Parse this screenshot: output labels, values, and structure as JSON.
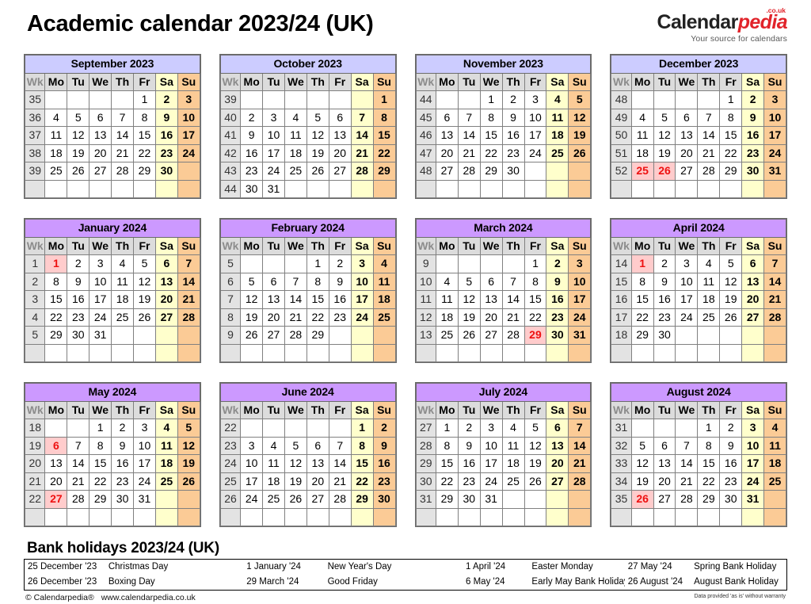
{
  "header": {
    "title": "Academic calendar 2023/24 (UK)",
    "brand_primary": "Calendar",
    "brand_secondary": "pedia",
    "brand_tld": ".co.uk",
    "brand_tagline": "Your source for calendars"
  },
  "colors": {
    "title_2023": "#ccccff",
    "title_2024": "#cc99ff",
    "saturday": "#ffffcc",
    "sunday": "#fbcb96",
    "holiday_bg": "#ffcccc",
    "holiday_text": "#ee1111",
    "weeknum_bg": "#e3e3e3",
    "dow_bg": "#dcdcdc",
    "brand_red": "#e1232a"
  },
  "day_headers": [
    "Wk",
    "Mo",
    "Tu",
    "We",
    "Th",
    "Fr",
    "Sa",
    "Su"
  ],
  "months": [
    {
      "name": "September 2023",
      "year_group": "2023",
      "weeks": [
        {
          "wk": "35",
          "days": [
            "",
            "",
            "",
            "",
            "1",
            "2",
            "3"
          ]
        },
        {
          "wk": "36",
          "days": [
            "4",
            "5",
            "6",
            "7",
            "8",
            "9",
            "10"
          ]
        },
        {
          "wk": "37",
          "days": [
            "11",
            "12",
            "13",
            "14",
            "15",
            "16",
            "17"
          ]
        },
        {
          "wk": "38",
          "days": [
            "18",
            "19",
            "20",
            "21",
            "22",
            "23",
            "24"
          ]
        },
        {
          "wk": "39",
          "days": [
            "25",
            "26",
            "27",
            "28",
            "29",
            "30",
            ""
          ]
        },
        {
          "wk": "",
          "days": [
            "",
            "",
            "",
            "",
            "",
            "",
            ""
          ]
        }
      ],
      "holidays": []
    },
    {
      "name": "October 2023",
      "year_group": "2023",
      "weeks": [
        {
          "wk": "39",
          "days": [
            "",
            "",
            "",
            "",
            "",
            "",
            "1"
          ]
        },
        {
          "wk": "40",
          "days": [
            "2",
            "3",
            "4",
            "5",
            "6",
            "7",
            "8"
          ]
        },
        {
          "wk": "41",
          "days": [
            "9",
            "10",
            "11",
            "12",
            "13",
            "14",
            "15"
          ]
        },
        {
          "wk": "42",
          "days": [
            "16",
            "17",
            "18",
            "19",
            "20",
            "21",
            "22"
          ]
        },
        {
          "wk": "43",
          "days": [
            "23",
            "24",
            "25",
            "26",
            "27",
            "28",
            "29"
          ]
        },
        {
          "wk": "44",
          "days": [
            "30",
            "31",
            "",
            "",
            "",
            "",
            ""
          ]
        }
      ],
      "holidays": []
    },
    {
      "name": "November 2023",
      "year_group": "2023",
      "weeks": [
        {
          "wk": "44",
          "days": [
            "",
            "",
            "1",
            "2",
            "3",
            "4",
            "5"
          ]
        },
        {
          "wk": "45",
          "days": [
            "6",
            "7",
            "8",
            "9",
            "10",
            "11",
            "12"
          ]
        },
        {
          "wk": "46",
          "days": [
            "13",
            "14",
            "15",
            "16",
            "17",
            "18",
            "19"
          ]
        },
        {
          "wk": "47",
          "days": [
            "20",
            "21",
            "22",
            "23",
            "24",
            "25",
            "26"
          ]
        },
        {
          "wk": "48",
          "days": [
            "27",
            "28",
            "29",
            "30",
            "",
            "",
            ""
          ]
        },
        {
          "wk": "",
          "days": [
            "",
            "",
            "",
            "",
            "",
            "",
            ""
          ]
        }
      ],
      "holidays": []
    },
    {
      "name": "December 2023",
      "year_group": "2023",
      "weeks": [
        {
          "wk": "48",
          "days": [
            "",
            "",
            "",
            "",
            "1",
            "2",
            "3"
          ]
        },
        {
          "wk": "49",
          "days": [
            "4",
            "5",
            "6",
            "7",
            "8",
            "9",
            "10"
          ]
        },
        {
          "wk": "50",
          "days": [
            "11",
            "12",
            "13",
            "14",
            "15",
            "16",
            "17"
          ]
        },
        {
          "wk": "51",
          "days": [
            "18",
            "19",
            "20",
            "21",
            "22",
            "23",
            "24"
          ]
        },
        {
          "wk": "52",
          "days": [
            "25",
            "26",
            "27",
            "28",
            "29",
            "30",
            "31"
          ]
        },
        {
          "wk": "",
          "days": [
            "",
            "",
            "",
            "",
            "",
            "",
            ""
          ]
        }
      ],
      "holidays": [
        "25",
        "26"
      ]
    },
    {
      "name": "January 2024",
      "year_group": "2024",
      "weeks": [
        {
          "wk": "1",
          "days": [
            "1",
            "2",
            "3",
            "4",
            "5",
            "6",
            "7"
          ]
        },
        {
          "wk": "2",
          "days": [
            "8",
            "9",
            "10",
            "11",
            "12",
            "13",
            "14"
          ]
        },
        {
          "wk": "3",
          "days": [
            "15",
            "16",
            "17",
            "18",
            "19",
            "20",
            "21"
          ]
        },
        {
          "wk": "4",
          "days": [
            "22",
            "23",
            "24",
            "25",
            "26",
            "27",
            "28"
          ]
        },
        {
          "wk": "5",
          "days": [
            "29",
            "30",
            "31",
            "",
            "",
            "",
            ""
          ]
        },
        {
          "wk": "",
          "days": [
            "",
            "",
            "",
            "",
            "",
            "",
            ""
          ]
        }
      ],
      "holidays": [
        "1"
      ]
    },
    {
      "name": "February 2024",
      "year_group": "2024",
      "weeks": [
        {
          "wk": "5",
          "days": [
            "",
            "",
            "",
            "1",
            "2",
            "3",
            "4"
          ]
        },
        {
          "wk": "6",
          "days": [
            "5",
            "6",
            "7",
            "8",
            "9",
            "10",
            "11"
          ]
        },
        {
          "wk": "7",
          "days": [
            "12",
            "13",
            "14",
            "15",
            "16",
            "17",
            "18"
          ]
        },
        {
          "wk": "8",
          "days": [
            "19",
            "20",
            "21",
            "22",
            "23",
            "24",
            "25"
          ]
        },
        {
          "wk": "9",
          "days": [
            "26",
            "27",
            "28",
            "29",
            "",
            "",
            ""
          ]
        },
        {
          "wk": "",
          "days": [
            "",
            "",
            "",
            "",
            "",
            "",
            ""
          ]
        }
      ],
      "holidays": []
    },
    {
      "name": "March 2024",
      "year_group": "2024",
      "weeks": [
        {
          "wk": "9",
          "days": [
            "",
            "",
            "",
            "",
            "1",
            "2",
            "3"
          ]
        },
        {
          "wk": "10",
          "days": [
            "4",
            "5",
            "6",
            "7",
            "8",
            "9",
            "10"
          ]
        },
        {
          "wk": "11",
          "days": [
            "11",
            "12",
            "13",
            "14",
            "15",
            "16",
            "17"
          ]
        },
        {
          "wk": "12",
          "days": [
            "18",
            "19",
            "20",
            "21",
            "22",
            "23",
            "24"
          ]
        },
        {
          "wk": "13",
          "days": [
            "25",
            "26",
            "27",
            "28",
            "29",
            "30",
            "31"
          ]
        },
        {
          "wk": "",
          "days": [
            "",
            "",
            "",
            "",
            "",
            "",
            ""
          ]
        }
      ],
      "holidays": [
        "29"
      ]
    },
    {
      "name": "April 2024",
      "year_group": "2024",
      "weeks": [
        {
          "wk": "14",
          "days": [
            "1",
            "2",
            "3",
            "4",
            "5",
            "6",
            "7"
          ]
        },
        {
          "wk": "15",
          "days": [
            "8",
            "9",
            "10",
            "11",
            "12",
            "13",
            "14"
          ]
        },
        {
          "wk": "16",
          "days": [
            "15",
            "16",
            "17",
            "18",
            "19",
            "20",
            "21"
          ]
        },
        {
          "wk": "17",
          "days": [
            "22",
            "23",
            "24",
            "25",
            "26",
            "27",
            "28"
          ]
        },
        {
          "wk": "18",
          "days": [
            "29",
            "30",
            "",
            "",
            "",
            "",
            ""
          ]
        },
        {
          "wk": "",
          "days": [
            "",
            "",
            "",
            "",
            "",
            "",
            ""
          ]
        }
      ],
      "holidays": [
        "1"
      ]
    },
    {
      "name": "May 2024",
      "year_group": "2024",
      "weeks": [
        {
          "wk": "18",
          "days": [
            "",
            "",
            "1",
            "2",
            "3",
            "4",
            "5"
          ]
        },
        {
          "wk": "19",
          "days": [
            "6",
            "7",
            "8",
            "9",
            "10",
            "11",
            "12"
          ]
        },
        {
          "wk": "20",
          "days": [
            "13",
            "14",
            "15",
            "16",
            "17",
            "18",
            "19"
          ]
        },
        {
          "wk": "21",
          "days": [
            "20",
            "21",
            "22",
            "23",
            "24",
            "25",
            "26"
          ]
        },
        {
          "wk": "22",
          "days": [
            "27",
            "28",
            "29",
            "30",
            "31",
            "",
            ""
          ]
        },
        {
          "wk": "",
          "days": [
            "",
            "",
            "",
            "",
            "",
            "",
            ""
          ]
        }
      ],
      "holidays": [
        "6",
        "27"
      ]
    },
    {
      "name": "June 2024",
      "year_group": "2024",
      "weeks": [
        {
          "wk": "22",
          "days": [
            "",
            "",
            "",
            "",
            "",
            "1",
            "2"
          ]
        },
        {
          "wk": "23",
          "days": [
            "3",
            "4",
            "5",
            "6",
            "7",
            "8",
            "9"
          ]
        },
        {
          "wk": "24",
          "days": [
            "10",
            "11",
            "12",
            "13",
            "14",
            "15",
            "16"
          ]
        },
        {
          "wk": "25",
          "days": [
            "17",
            "18",
            "19",
            "20",
            "21",
            "22",
            "23"
          ]
        },
        {
          "wk": "26",
          "days": [
            "24",
            "25",
            "26",
            "27",
            "28",
            "29",
            "30"
          ]
        },
        {
          "wk": "",
          "days": [
            "",
            "",
            "",
            "",
            "",
            "",
            ""
          ]
        }
      ],
      "holidays": []
    },
    {
      "name": "July 2024",
      "year_group": "2024",
      "weeks": [
        {
          "wk": "27",
          "days": [
            "1",
            "2",
            "3",
            "4",
            "5",
            "6",
            "7"
          ]
        },
        {
          "wk": "28",
          "days": [
            "8",
            "9",
            "10",
            "11",
            "12",
            "13",
            "14"
          ]
        },
        {
          "wk": "29",
          "days": [
            "15",
            "16",
            "17",
            "18",
            "19",
            "20",
            "21"
          ]
        },
        {
          "wk": "30",
          "days": [
            "22",
            "23",
            "24",
            "25",
            "26",
            "27",
            "28"
          ]
        },
        {
          "wk": "31",
          "days": [
            "29",
            "30",
            "31",
            "",
            "",
            "",
            ""
          ]
        },
        {
          "wk": "",
          "days": [
            "",
            "",
            "",
            "",
            "",
            "",
            ""
          ]
        }
      ],
      "holidays": []
    },
    {
      "name": "August 2024",
      "year_group": "2024",
      "weeks": [
        {
          "wk": "31",
          "days": [
            "",
            "",
            "",
            "1",
            "2",
            "3",
            "4"
          ]
        },
        {
          "wk": "32",
          "days": [
            "5",
            "6",
            "7",
            "8",
            "9",
            "10",
            "11"
          ]
        },
        {
          "wk": "33",
          "days": [
            "12",
            "13",
            "14",
            "15",
            "16",
            "17",
            "18"
          ]
        },
        {
          "wk": "34",
          "days": [
            "19",
            "20",
            "21",
            "22",
            "23",
            "24",
            "25"
          ]
        },
        {
          "wk": "35",
          "days": [
            "26",
            "27",
            "28",
            "29",
            "30",
            "31",
            ""
          ]
        },
        {
          "wk": "",
          "days": [
            "",
            "",
            "",
            "",
            "",
            "",
            ""
          ]
        }
      ],
      "holidays": [
        "26"
      ]
    }
  ],
  "bank_holidays": {
    "title": "Bank holidays 2023/24 (UK)",
    "rows": [
      [
        {
          "date": "25 December '23",
          "name": "Christmas Day"
        },
        {
          "date": "1 January '24",
          "name": "New Year's Day"
        },
        {
          "date": "1 April '24",
          "name": "Easter Monday"
        },
        {
          "date": "27 May '24",
          "name": "Spring Bank Holiday"
        }
      ],
      [
        {
          "date": "26 December '23",
          "name": "Boxing Day"
        },
        {
          "date": "29 March '24",
          "name": "Good Friday"
        },
        {
          "date": "6 May '24",
          "name": "Early May Bank Holiday"
        },
        {
          "date": "26 August '24",
          "name": "August Bank Holiday"
        }
      ]
    ]
  },
  "footer": {
    "copyright": "© Calendarpedia®",
    "url": "www.calendarpedia.co.uk",
    "disclaimer": "Data provided 'as is' without warranty"
  }
}
